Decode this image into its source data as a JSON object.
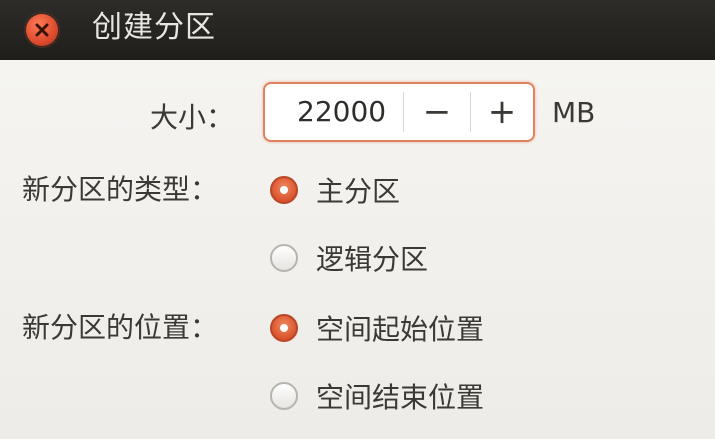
{
  "window": {
    "title": "创建分区"
  },
  "form": {
    "size_label": "大小：",
    "size_value": "22000",
    "minus_label": "−",
    "plus_label": "+",
    "unit": "MB",
    "type_label": "新分区的类型：",
    "type_options": [
      {
        "label": "主分区",
        "selected": true
      },
      {
        "label": "逻辑分区",
        "selected": false
      }
    ],
    "location_label": "新分区的位置：",
    "location_options": [
      {
        "label": "空间起始位置",
        "selected": true
      },
      {
        "label": "空间结束位置",
        "selected": false
      }
    ]
  },
  "colors": {
    "accent": "#d9532d",
    "titlebar": "#2d2c29",
    "background": "#f3f2ef"
  }
}
